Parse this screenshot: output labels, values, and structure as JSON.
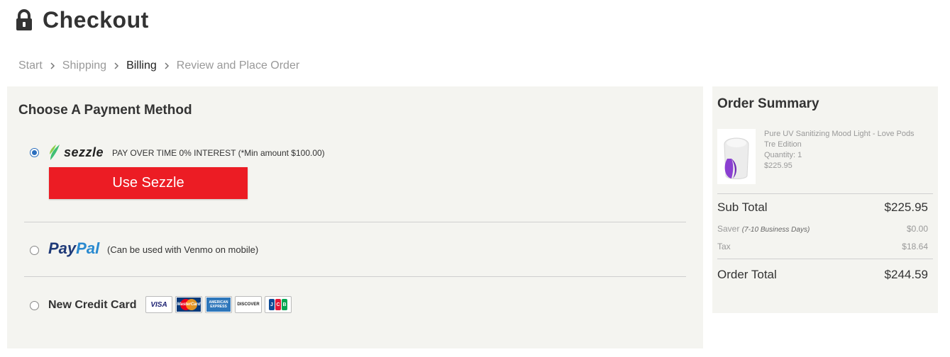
{
  "header": {
    "title": "Checkout",
    "icon": "lock-icon"
  },
  "breadcrumb": {
    "items": [
      "Start",
      "Shipping",
      "Billing",
      "Review and Place Order"
    ],
    "active": "Billing"
  },
  "payment": {
    "section_title": "Choose A Payment Method",
    "sezzle": {
      "logo_text": "sezzle",
      "description": "PAY OVER TIME 0% INTEREST (*Min amount $100.00)",
      "button_label": "Use Sezzle",
      "selected": true,
      "button_color": "#ec1c24"
    },
    "paypal": {
      "logo_pay": "Pay",
      "logo_pal": "Pal",
      "description": "(Can be used with Venmo on mobile)",
      "selected": false
    },
    "credit_card": {
      "label": "New Credit Card",
      "selected": false,
      "cards": [
        "VISA",
        "MasterCard",
        "AMERICAN EXPRESS",
        "DISCOVER",
        "JCB"
      ]
    }
  },
  "summary": {
    "title": "Order Summary",
    "product": {
      "name": "Pure UV Sanitizing Mood Light - Love Pods Tre Edition",
      "quantity": "Quantity: 1",
      "price": "$225.95"
    },
    "subtotal_label": "Sub Total",
    "subtotal_value": "$225.95",
    "saver_label": "Saver",
    "saver_note": "(7-10 Business Days)",
    "saver_value": "$0.00",
    "tax_label": "Tax",
    "tax_value": "$18.64",
    "total_label": "Order Total",
    "total_value": "$244.59"
  }
}
